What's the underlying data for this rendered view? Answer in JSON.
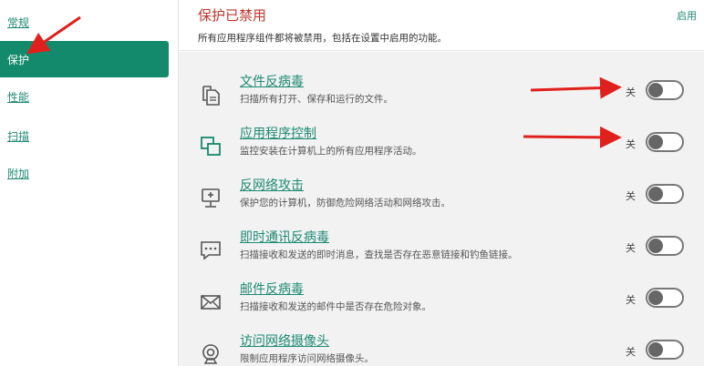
{
  "sidebar": {
    "items": [
      {
        "label": "常规",
        "active": false
      },
      {
        "label": "保护",
        "active": true
      },
      {
        "label": "性能",
        "active": false
      },
      {
        "label": "扫描",
        "active": false
      },
      {
        "label": "附加",
        "active": false
      }
    ]
  },
  "header": {
    "title": "保护已禁用",
    "description": "所有应用程序组件都将被禁用，包括在设置中启用的功能。",
    "enable_label": "启用"
  },
  "components": [
    {
      "icon": "file-antivirus-icon",
      "title": "文件反病毒",
      "description": "扫描所有打开、保存和运行的文件。",
      "state": "关",
      "on": false
    },
    {
      "icon": "app-control-icon",
      "title": "应用程序控制",
      "description": "监控安装在计算机上的所有应用程序活动。",
      "state": "关",
      "on": false
    },
    {
      "icon": "network-attack-icon",
      "title": "反网络攻击",
      "description": "保护您的计算机，防御危险网络活动和网络攻击。",
      "state": "关",
      "on": false
    },
    {
      "icon": "im-antivirus-icon",
      "title": "即时通讯反病毒",
      "description": "扫描接收和发送的即时消息，查找是否存在恶意链接和钓鱼链接。",
      "state": "关",
      "on": false
    },
    {
      "icon": "mail-antivirus-icon",
      "title": "邮件反病毒",
      "description": "扫描接收和发送的邮件中是否存在危险对象。",
      "state": "关",
      "on": false
    },
    {
      "icon": "webcam-icon",
      "title": "访问网络摄像头",
      "description": "限制应用程序访问网络摄像头。",
      "state": "关",
      "on": false
    }
  ],
  "colors": {
    "accent": "#138a6b",
    "link": "#1d8a74",
    "disabled_title": "#c0342b",
    "annotation_arrow": "#e0201c"
  }
}
